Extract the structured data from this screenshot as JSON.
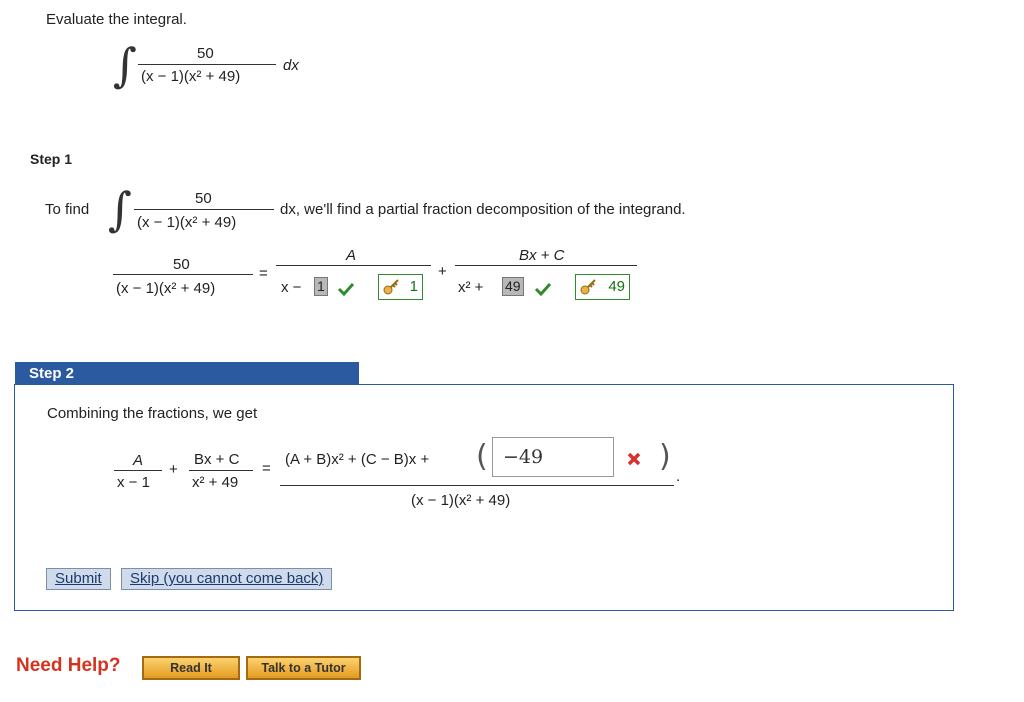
{
  "problem": {
    "prompt": "Evaluate the integral.",
    "numerator": "50",
    "denominator": "(x − 1)(x² + 49)",
    "dx": "dx"
  },
  "step1": {
    "title": "Step 1",
    "to_find": "To find",
    "numerator": "50",
    "denominator": "(x − 1)(x² + 49)",
    "explanation": "dx, we'll find a partial fraction decomposition of the integrand.",
    "lhs_numerator": "50",
    "lhs_denominator": "(x − 1)(x² + 49)",
    "equals": "=",
    "term1_numerator": "A",
    "term1_denominator_prefix": "x −",
    "term1_input_value": "1",
    "term1_answer": "1",
    "plus": "+",
    "term2_numerator": "Bx + C",
    "term2_denominator_prefix": "x² +",
    "term2_input_value": "49",
    "term2_answer": "49"
  },
  "step2": {
    "title": "Step 2",
    "intro": "Combining the fractions, we get",
    "frac1_num": "A",
    "frac1_den": "x − 1",
    "plus": "+",
    "frac2_num": "Bx + C",
    "frac2_den": "x² + 49",
    "equals": "=",
    "rhs_numerator_prefix": "(A + B)x² + (C − B)x +",
    "rhs_input_value": "−49",
    "rhs_denominator": "(x − 1)(x² + 49)",
    "period": "."
  },
  "buttons": {
    "submit": "Submit",
    "skip": "Skip (you cannot come back)"
  },
  "help": {
    "label": "Need Help?",
    "read_it": "Read It",
    "talk_to_tutor": "Talk to a Tutor"
  },
  "colors": {
    "accent_blue": "#2b5aa0",
    "correct_green": "#2e8b2e",
    "incorrect_red": "#d9302c",
    "help_red": "#d6331f"
  }
}
